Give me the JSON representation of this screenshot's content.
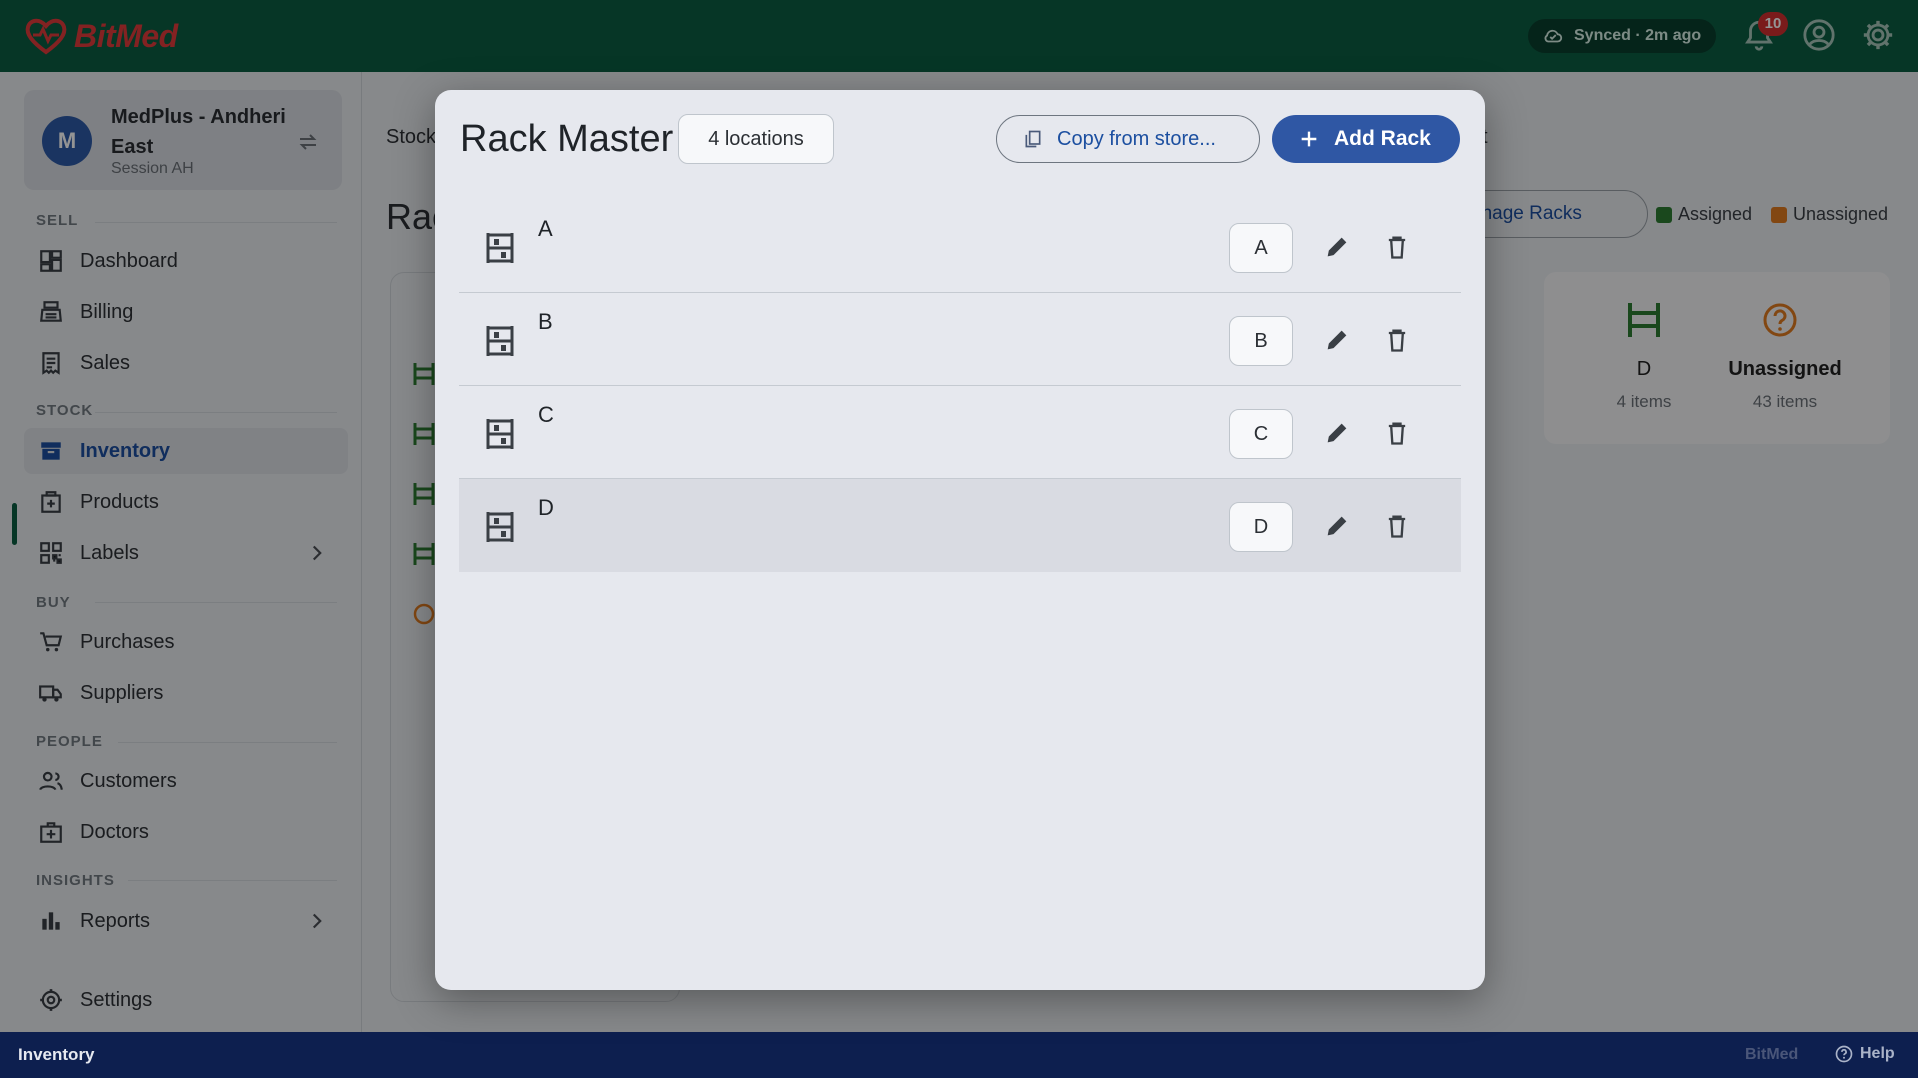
{
  "app": {
    "brand": "BitMed"
  },
  "topbar": {
    "sync_status": "Synced · 2m ago",
    "notification_count": "10"
  },
  "store": {
    "avatar_initial": "M",
    "name": "MedPlus - Andheri East",
    "session": "Session AH"
  },
  "sidebar": {
    "sections": {
      "sell": "SELL",
      "stock": "STOCK",
      "buy": "BUY",
      "people": "PEOPLE",
      "insights": "INSIGHTS"
    },
    "items": {
      "dashboard": "Dashboard",
      "billing": "Billing",
      "sales": "Sales",
      "inventory": "Inventory",
      "products": "Products",
      "labels": "Labels",
      "purchases": "Purchases",
      "suppliers": "Suppliers",
      "customers": "Customers",
      "doctors": "Doctors",
      "reports": "Reports",
      "settings": "Settings"
    }
  },
  "background": {
    "tab_partial": "Stock",
    "tab_partial_right": "t",
    "title_partial": "Rac",
    "manage_racks": "anage Racks",
    "legend_assigned": "Assigned",
    "legend_unassigned": "Unassigned",
    "cards": [
      {
        "label": "D",
        "count": "4 items"
      },
      {
        "label": "Unassigned",
        "count": "43 items"
      }
    ]
  },
  "modal": {
    "title": "Rack Master",
    "locations_count": "4 locations",
    "copy_button": "Copy from store...",
    "add_button": "Add Rack",
    "racks": [
      {
        "name": "A",
        "code": "A"
      },
      {
        "name": "B",
        "code": "B"
      },
      {
        "name": "C",
        "code": "C"
      },
      {
        "name": "D",
        "code": "D"
      }
    ]
  },
  "footer": {
    "current_page": "Inventory",
    "brand": "BitMed",
    "help": "Help"
  },
  "colors": {
    "topbar": "#0b5e43",
    "primary": "#2f57a4",
    "footer": "#0d1f4f",
    "assigned": "#2e7d32",
    "unassigned": "#e07a1f"
  }
}
